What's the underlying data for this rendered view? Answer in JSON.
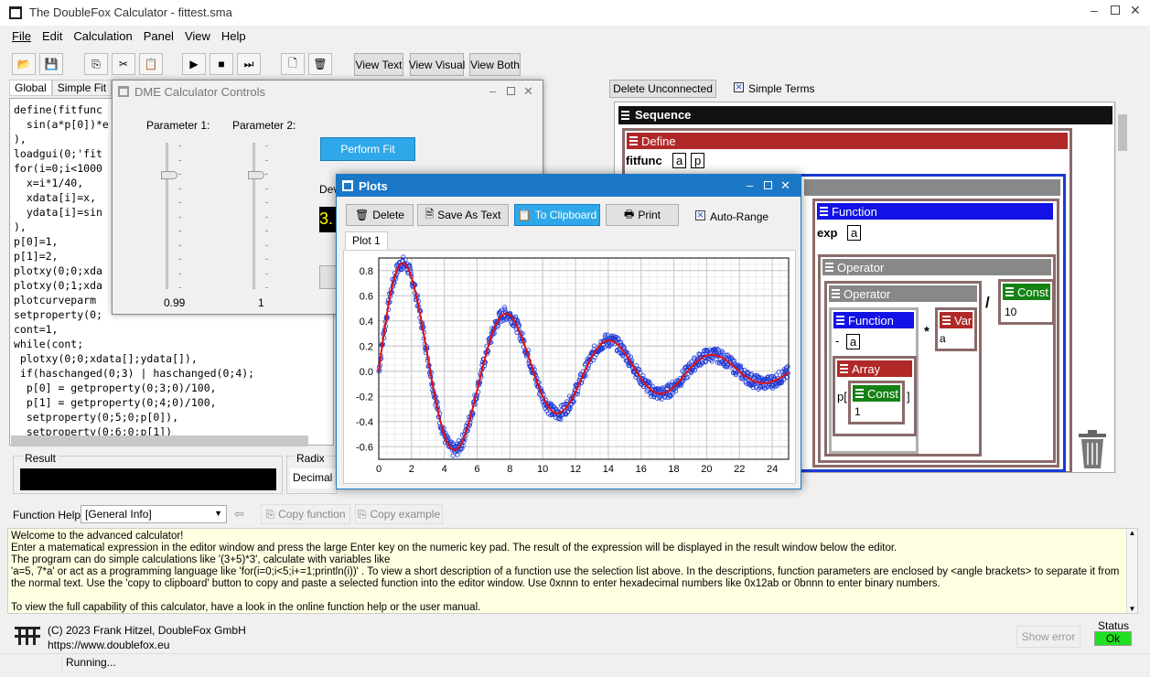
{
  "app": {
    "title": "The DoubleFox Calculator - fittest.sma"
  },
  "menu": [
    "File",
    "Edit",
    "Calculation",
    "Panel",
    "View",
    "Help"
  ],
  "toolbar": {
    "view_text": "View Text",
    "view_visual": "View Visual",
    "view_both": "View Both"
  },
  "tabs": [
    "Global",
    "Simple Fit",
    "G"
  ],
  "editor_lines": [
    "define(fitfunc",
    "  sin(a*p[0])*e",
    "),",
    "loadgui(0;'fit",
    "for(i=0;i<1000",
    "  x=i*1/40,",
    "  xdata[i]=x,",
    "  ydata[i]=sin",
    "),",
    "p[0]=1,",
    "p[1]=2,",
    "plotxy(0;0;xda",
    "plotxy(0;1;xda",
    "plotcurveparm",
    "setproperty(0;",
    "cont=1,",
    "while(cont;",
    " plotxy(0;0;xdata[];ydata[]),",
    " if(haschanged(0;3) | haschanged(0;4);",
    "  p[0] = getproperty(0;3;0)/100,",
    "  p[1] = getproperty(0;4;0)/100,",
    "  setproperty(0;5;0;p[0]),",
    "  setproperty(0;6;0;p[1])"
  ],
  "result": {
    "label": "Result",
    "value": ""
  },
  "radix": {
    "label": "Radix",
    "value": "Decimal"
  },
  "dme": {
    "title": "DME Calculator Controls",
    "param1_label": "Parameter 1:",
    "param2_label": "Parameter 2:",
    "param1_value": "0.99",
    "param2_value": "1",
    "param1_level": 0.22,
    "param2_level": 0.22,
    "perform_fit": "Perform Fit",
    "dev_label": "Dev",
    "dev_value": "3."
  },
  "plots": {
    "title": "Plots",
    "delete": "Delete",
    "save_text": "Save As Text",
    "clipboard": "To Clipboard",
    "print": "Print",
    "autorange": "Auto-Range",
    "tab": "Plot 1"
  },
  "chart_data": {
    "type": "scatter",
    "xlim": [
      0,
      25
    ],
    "ylim": [
      -0.7,
      0.9
    ],
    "xticks": [
      0,
      2,
      4,
      6,
      8,
      10,
      12,
      14,
      16,
      18,
      20,
      22,
      24
    ],
    "yticks": [
      -0.6,
      -0.4,
      -0.2,
      0.0,
      0.2,
      0.4,
      0.6,
      0.8
    ],
    "tick_labels_y": [
      "-0.6",
      "-0.4",
      "-0.2",
      "0.0",
      "0.2",
      "0.4",
      "0.6",
      "0.8"
    ],
    "tick_labels_x": [
      "0",
      "2",
      "4",
      "6",
      "8",
      "10",
      "12",
      "14",
      "16",
      "18",
      "20",
      "22",
      "24"
    ],
    "series": [
      {
        "style": "markers",
        "color": "#1e3ad6",
        "model": "sin(x)*exp(-0.1*x) with noise, x from 0 to 25"
      },
      {
        "style": "line",
        "color": "#e01010",
        "model": "sin(x)*exp(-0.1*x), x from 0 to 25"
      }
    ],
    "grid": true
  },
  "visual": {
    "delete_unconnected": "Delete Unconnected",
    "simple_terms": "Simple Terms",
    "sequence": "Sequence",
    "define": "Define",
    "fitfunc": "fitfunc",
    "a": "a",
    "p": "p",
    "function": "Function",
    "exp": "exp",
    "operator": "Operator",
    "const": "Const",
    "ten": "10",
    "div": "/",
    "mul": "*",
    "var": "Var",
    "minus": "-",
    "array": "Array",
    "one": "1",
    "p_open": "p[",
    "p_close": "]"
  },
  "help": {
    "label": "Function Help:",
    "select": "[General Info]",
    "copy_function": "Copy function",
    "copy_example": "Copy example",
    "lines": [
      "Welcome to the advanced calculator!",
      "Enter a matematical expression in the editor window and press the large Enter key on the numeric key pad. The result of the expression will be displayed in the result window below the editor.",
      "The program can do simple calculations like '(3+5)*3', calculate with variables like",
      "'a=5, 7*a' or act as a programming language like 'for(i=0;i<5;i+=1;println(i))' . To view a short description of a function use the selection list above. In the descriptions, function parameters are enclosed by <angle brackets> to separate it from the normal text. Use the 'copy to clipboard' button to copy and paste a selected function into the editor window. Use 0xnnn to enter hexadecimal numbers like 0x12ab or 0bnnn to enter binary numbers.",
      "",
      "To view the full capability of this calculator, have a look in the online function help or the user manual."
    ]
  },
  "footer": {
    "copyright": "(C) 2023 Frank Hitzel, DoubleFox GmbH",
    "url": "https://www.doublefox.eu",
    "show_error": "Show error",
    "status_label": "Status",
    "status_value": "Ok",
    "running": "Running..."
  }
}
